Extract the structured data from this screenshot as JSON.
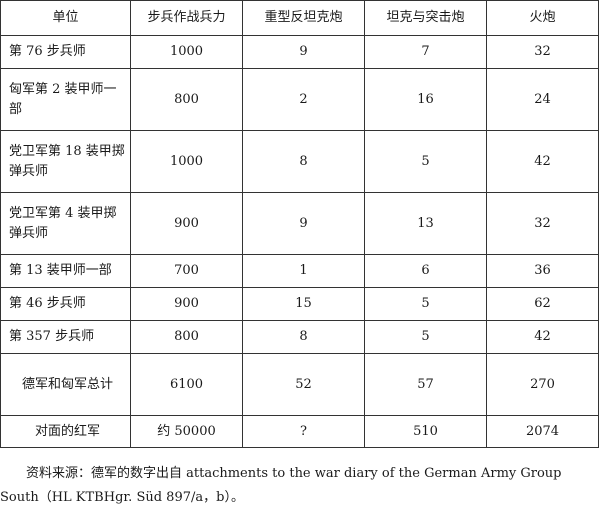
{
  "table": {
    "headers": [
      "单位",
      "步兵作战兵力",
      "重型反坦克炮",
      "坦克与突击炮",
      "火炮"
    ],
    "rows": [
      [
        "第 76 步兵师",
        "1000",
        "9",
        "7",
        "32"
      ],
      [
        "匈军第 2 装甲师一部",
        "800",
        "2",
        "16",
        "24"
      ],
      [
        "党卫军第 18 装甲掷弹兵师",
        "1000",
        "8",
        "5",
        "42"
      ],
      [
        "党卫军第 4 装甲掷弹兵师",
        "900",
        "9",
        "13",
        "32"
      ],
      [
        "第 13 装甲师一部",
        "700",
        "1",
        "6",
        "36"
      ],
      [
        "第 46 步兵师",
        "900",
        "15",
        "5",
        "62"
      ],
      [
        "第 357 步兵师",
        "800",
        "8",
        "5",
        "42"
      ],
      [
        "德军和匈军总计",
        "6100",
        "52",
        "57",
        "270"
      ],
      [
        "对面的红军",
        "约 50000",
        "?",
        "510",
        "2074"
      ]
    ]
  },
  "source_note": "资料来源：德军的数字出自 attachments to the war diary of the German Army Group South（HL KTBHgr. Süd 897/a，b）。"
}
